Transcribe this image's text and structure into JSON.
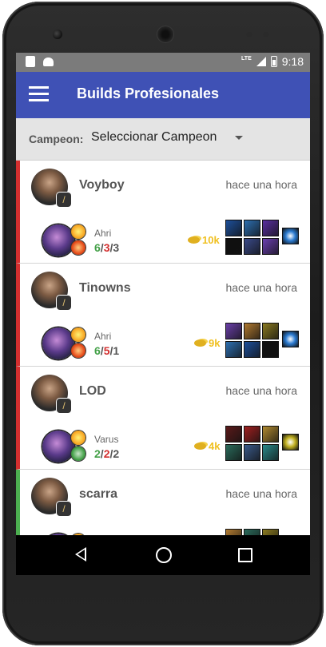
{
  "status_bar": {
    "time": "9:18",
    "network": "LTE"
  },
  "app_bar": {
    "title": "Builds Profesionales"
  },
  "filter": {
    "label": "Campeon:",
    "value": "Seleccionar Campeon"
  },
  "colors": {
    "primary": "#3f51b5",
    "loss": "#d32f2f",
    "win": "#4caf50",
    "gold": "#f0c020"
  },
  "builds": [
    {
      "player": "Voyboy",
      "time": "hace una hora",
      "result": "loss",
      "champion": "Ahri",
      "kills": "6",
      "deaths": "3",
      "assists": "3",
      "gold": "10k",
      "spells": [
        "flash-icon",
        "ignite-icon"
      ],
      "items": [
        "#1d4f9a",
        "#2d6fb0",
        "#5a2fa0",
        "#101010",
        "#3a4a8a",
        "#6b3fb0"
      ],
      "trinket": "#2a7ad0"
    },
    {
      "player": "Tinowns",
      "time": "hace una hora",
      "result": "loss",
      "champion": "Ahri",
      "kills": "6",
      "deaths": "5",
      "assists": "1",
      "gold": "9k",
      "spells": [
        "flash-icon",
        "ignite-icon"
      ],
      "items": [
        "#6a3fa8",
        "#b07a30",
        "#8a7a20",
        "#2d6fb0",
        "#1d4f9a",
        "#101010"
      ],
      "trinket": "#2a7ad0"
    },
    {
      "player": "LOD",
      "time": "hace una hora",
      "result": "loss",
      "champion": "Varus",
      "kills": "2",
      "deaths": "2",
      "assists": "2",
      "gold": "4k",
      "spells": [
        "flash-icon",
        "heal-icon"
      ],
      "items": [
        "#5a1a1a",
        "#a02020",
        "#b08a30",
        "#2a6a5a",
        "#3a5a8a",
        "#2a8a8a"
      ],
      "trinket": "#c0b020"
    },
    {
      "player": "scarra",
      "time": "hace una hora",
      "result": "win",
      "champion": "",
      "kills": "",
      "deaths": "",
      "assists": "",
      "gold": "",
      "spells": [
        "flash-icon",
        "ignite-icon"
      ],
      "items": [
        "#b07a30",
        "#2a6a5a",
        "#8a7a20"
      ],
      "trinket": ""
    }
  ]
}
